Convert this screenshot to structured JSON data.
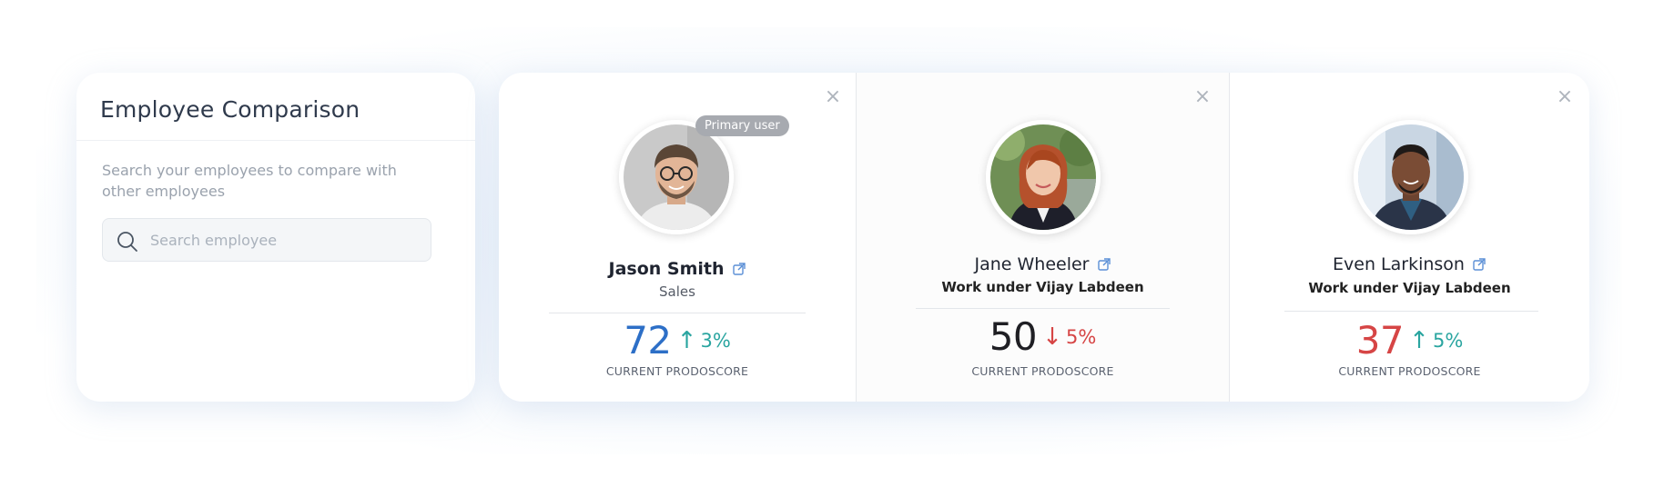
{
  "colors": {
    "score_blue": "#2d6fc7",
    "score_dark": "#1f1f24",
    "score_red": "#d64545",
    "trend_up": "#2aa5a0",
    "trend_down": "#d64545",
    "badge_gray": "#a7aab0",
    "link_blue": "#5b8fd6"
  },
  "left_panel": {
    "title": "Employee Comparison",
    "description": "Search your employees to compare with other employees",
    "search_placeholder": "Search employee"
  },
  "employees": [
    {
      "name": "Jason Smith",
      "subtitle": "Sales",
      "badge": "Primary user",
      "score": "72",
      "trend_direction": "up",
      "trend_arrow": "↑",
      "trend_percent": "3%",
      "score_label": "CURRENT PRODOSCORE",
      "close": "×"
    },
    {
      "name": "Jane Wheeler",
      "subtitle": "Work under Vijay Labdeen",
      "score": "50",
      "trend_direction": "down",
      "trend_arrow": "↓",
      "trend_percent": "5%",
      "score_label": "CURRENT PRODOSCORE",
      "close": "×"
    },
    {
      "name": "Even Larkinson",
      "subtitle": "Work under Vijay Labdeen",
      "score": "37",
      "trend_direction": "up",
      "trend_arrow": "↑",
      "trend_percent": "5%",
      "score_label": "CURRENT PRODOSCORE",
      "close": "×"
    }
  ]
}
